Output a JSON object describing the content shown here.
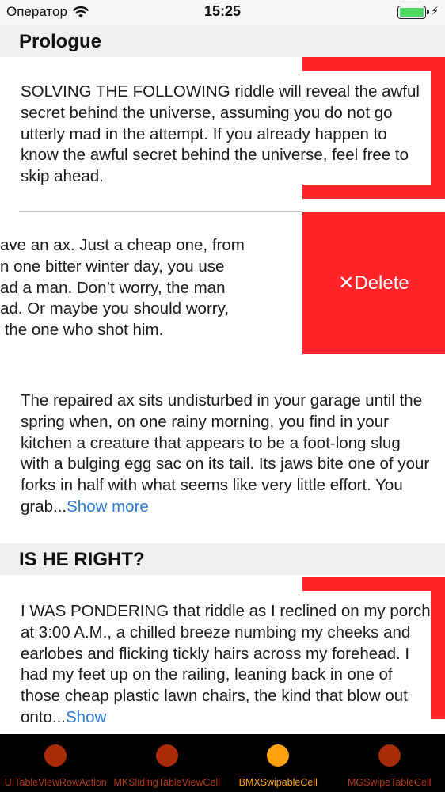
{
  "status_bar": {
    "carrier": "Оператор",
    "time": "15:25"
  },
  "sections": [
    {
      "title": "Prologue"
    },
    {
      "title": "IS HE RIGHT?"
    }
  ],
  "cells": [
    {
      "text": "SOLVING THE FOLLOWING riddle will reveal the awful secret behind the universe, assuming you do not go utterly mad in the attempt. If you already happen to know the awful secret behind the universe, feel free to skip ahead."
    },
    {
      "lines": [
        "ave an ax. Just a cheap one, from",
        "n one bitter winter day, you use",
        "ad a man. Don’t worry, the man",
        "ad. Or maybe you should worry,",
        " the one who shot him."
      ],
      "delete_label": "✕Delete"
    },
    {
      "text": "The repaired ax sits undisturbed in your garage until the spring when, on one rainy morning, you find in your kitchen a creature that appears to be a foot-long slug with a bulging egg sac on its tail. Its jaws bite one of your forks in half with what seems like very little effort. You grab...",
      "show_more": "Show more"
    },
    {
      "text": "I WAS PONDERING that riddle as I reclined on my porch at 3:00 A.M., a chilled breeze numbing my cheeks and earlobes and flicking tickly hairs across my forehead. I had my feet up on the railing, leaning back in one of those cheap plastic lawn chairs, the kind that blow out onto...",
      "show_more": "Show"
    }
  ],
  "tabs": [
    {
      "label": "UITableViewRowAction",
      "active": false
    },
    {
      "label": "MKSlidingTableViewCell",
      "active": false
    },
    {
      "label": "BMXSwipableCell",
      "active": true
    },
    {
      "label": "MGSwipeTableCell",
      "active": false
    }
  ],
  "colors": {
    "accent_red": "#ff2529",
    "link_blue": "#2a7bd8",
    "tab_active": "#ffa20e",
    "tab_inactive": "#aa2b07",
    "battery": "#4cd964"
  }
}
